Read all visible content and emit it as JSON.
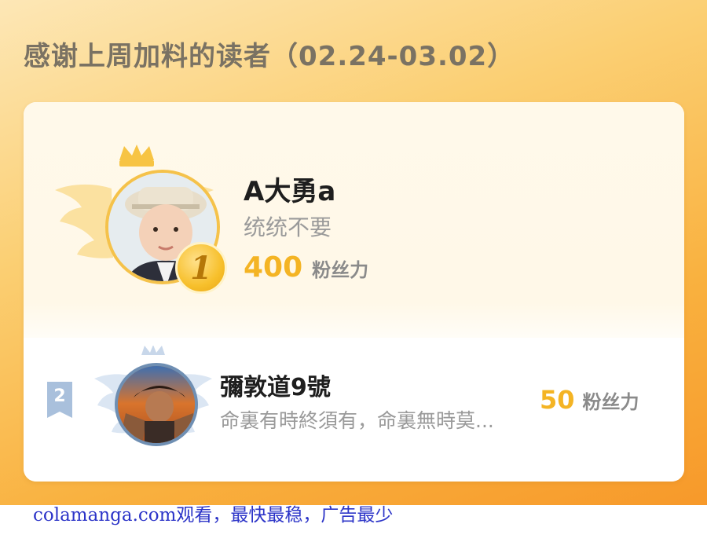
{
  "header": {
    "title": "感谢上周加料的读者（02.24-03.02）"
  },
  "top_reader": {
    "rank": "1",
    "name": "A大勇a",
    "message": "统统不要",
    "points": "400",
    "points_unit": "粉丝力"
  },
  "second_reader": {
    "rank": "2",
    "name": "彌敦道9號",
    "message": "命裏有時終須有，命裏無時莫...",
    "points": "50",
    "points_unit": "粉丝力"
  },
  "watermark": {
    "text": "colamanga.com观看，最快最稳，广告最少"
  },
  "colors": {
    "gold": "#f4b424",
    "banner": "#f9b13f",
    "watermark": "#2c34c8"
  },
  "icons": [
    "crown-icon",
    "wing-icon",
    "medal-icon",
    "rank-ribbon-icon"
  ]
}
